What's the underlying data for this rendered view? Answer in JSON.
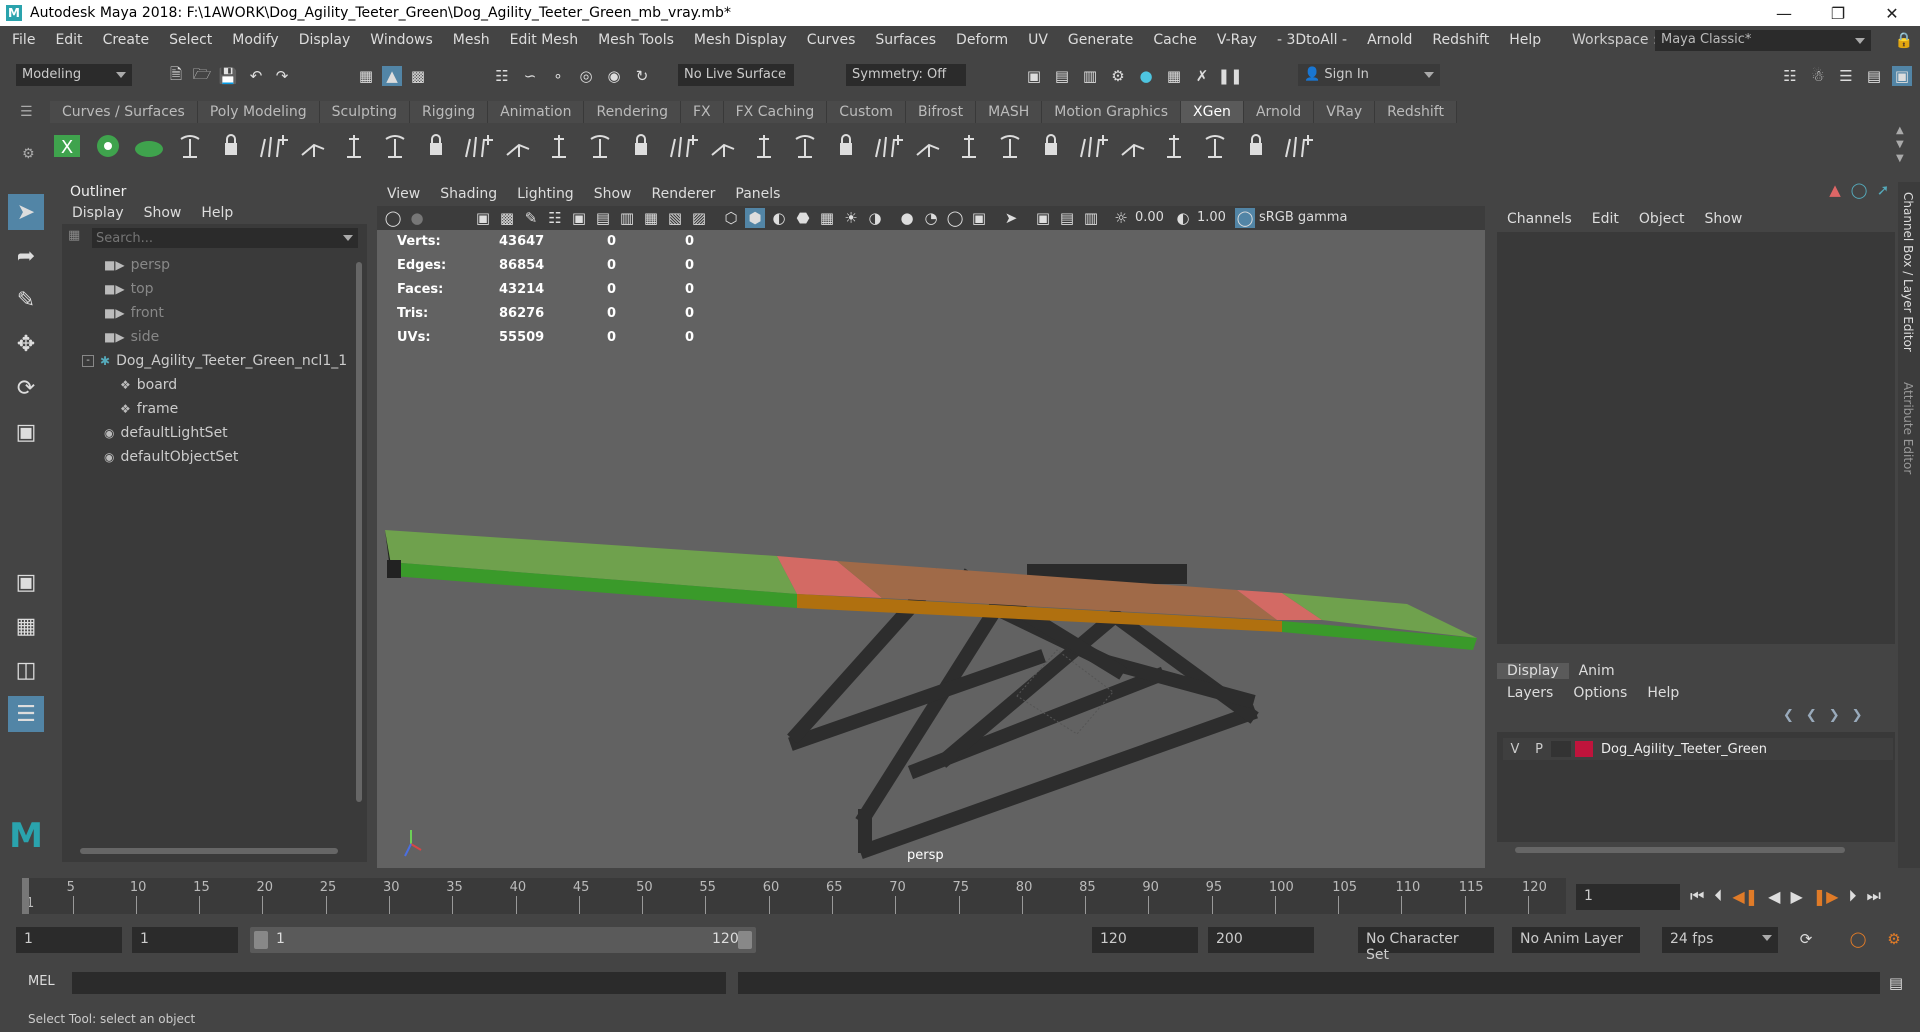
{
  "window": {
    "title": "Autodesk Maya 2018: F:\\1AWORK\\Dog_Agility_Teeter_Green\\Dog_Agility_Teeter_Green_mb_vray.mb*",
    "logo": "M"
  },
  "menubar": {
    "items": [
      "File",
      "Edit",
      "Create",
      "Select",
      "Modify",
      "Display",
      "Windows",
      "Mesh",
      "Edit Mesh",
      "Mesh Tools",
      "Mesh Display",
      "Curves",
      "Surfaces",
      "Deform",
      "UV",
      "Generate",
      "Cache",
      "V-Ray",
      "- 3DtoAll -",
      "Arnold",
      "Redshift",
      "Help"
    ],
    "workspace_label": "Workspace :",
    "workspace_value": "Maya Classic*"
  },
  "statusline": {
    "mode": "Modeling",
    "live_surface": "No Live Surface",
    "symmetry": "Symmetry: Off",
    "sign_in": "Sign In"
  },
  "shelf": {
    "tabs": [
      "Curves / Surfaces",
      "Poly Modeling",
      "Sculpting",
      "Rigging",
      "Animation",
      "Rendering",
      "FX",
      "FX Caching",
      "Custom",
      "Bifrost",
      "MASH",
      "Motion Graphics",
      "XGen",
      "Arnold",
      "VRay",
      "Redshift"
    ],
    "active_tab": "XGen"
  },
  "outliner": {
    "title": "Outliner",
    "menu": [
      "Display",
      "Show",
      "Help"
    ],
    "search_placeholder": "Search...",
    "items": [
      {
        "label": "persp",
        "dim": true
      },
      {
        "label": "top",
        "dim": true
      },
      {
        "label": "front",
        "dim": true
      },
      {
        "label": "side",
        "dim": true
      },
      {
        "label": "Dog_Agility_Teeter_Green_ncl1_1",
        "dim": false
      },
      {
        "label": "board",
        "dim": false
      },
      {
        "label": "frame",
        "dim": false
      },
      {
        "label": "defaultLightSet",
        "dim": false
      },
      {
        "label": "defaultObjectSet",
        "dim": false
      }
    ]
  },
  "viewport": {
    "menu": [
      "View",
      "Shading",
      "Lighting",
      "Show",
      "Renderer",
      "Panels"
    ],
    "exposure": "0.00",
    "gamma": "1.00",
    "colorspace": "sRGB gamma",
    "camera_label": "persp",
    "hud": [
      {
        "label": "Verts:",
        "v1": "43647",
        "v2": "0",
        "v3": "0"
      },
      {
        "label": "Edges:",
        "v1": "86854",
        "v2": "0",
        "v3": "0"
      },
      {
        "label": "Faces:",
        "v1": "43214",
        "v2": "0",
        "v3": "0"
      },
      {
        "label": "Tris:",
        "v1": "86276",
        "v2": "0",
        "v3": "0"
      },
      {
        "label": "UVs:",
        "v1": "55509",
        "v2": "0",
        "v3": "0"
      }
    ]
  },
  "channelbox": {
    "menu": [
      "Channels",
      "Edit",
      "Object",
      "Show"
    ],
    "side_tab_1": "Channel Box / Layer Editor",
    "side_tab_2": "Attribute Editor",
    "layer_tabs": [
      "Display",
      "Anim"
    ],
    "layer_menu": [
      "Layers",
      "Options",
      "Help"
    ],
    "layer": {
      "v": "V",
      "p": "P",
      "name": "Dog_Agility_Teeter_Green",
      "color": "#c0143c"
    }
  },
  "timeline": {
    "ticks": [
      "1",
      "5",
      "10",
      "15",
      "20",
      "25",
      "30",
      "35",
      "40",
      "45",
      "50",
      "55",
      "60",
      "65",
      "70",
      "75",
      "80",
      "85",
      "90",
      "95",
      "100",
      "105",
      "110",
      "115",
      "120"
    ],
    "current_frame": "1"
  },
  "range": {
    "start": "1",
    "playback_start": "1",
    "slider_start": "1",
    "slider_end": "120",
    "playback_end": "120",
    "end": "200",
    "character_set": "No Character Set",
    "anim_layer": "No Anim Layer",
    "fps": "24 fps"
  },
  "mel": {
    "label": "MEL"
  },
  "helpline": {
    "text": "Select Tool: select an object"
  },
  "colors": {
    "accent": "#5285a6",
    "shelf_green": "#3fa34d"
  }
}
